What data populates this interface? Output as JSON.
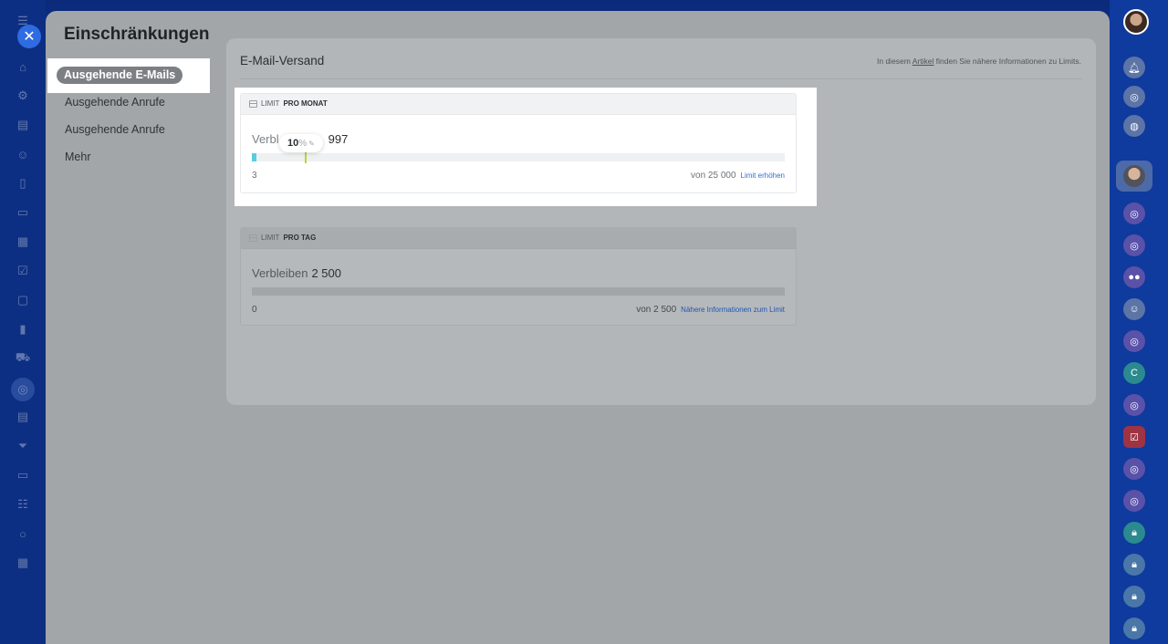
{
  "modal": {
    "title": "Einschränkungen",
    "menu": [
      {
        "label": "Ausgehende E-Mails",
        "active": true
      },
      {
        "label": "Ausgehende Anrufe"
      },
      {
        "label": "Ausgehende Anrufe"
      },
      {
        "label": "Mehr"
      }
    ]
  },
  "content": {
    "title": "E-Mail-Versand",
    "note_before": "In diesem",
    "note_link": "Artikel",
    "note_after": "finden Sie nähere Informationen zu Limits."
  },
  "monthly": {
    "head_prefix": "LIMIT",
    "head_strong": "PRO MONAT",
    "remain_label": "Verbl",
    "remain_value": "997",
    "used": "3",
    "of": "von 25 000",
    "action": "Limit erhöhen",
    "used_fraction": 0.0012,
    "marker_percent": 10,
    "tooltip_value": "10",
    "tooltip_unit": "%"
  },
  "daily": {
    "head_prefix": "LIMIT",
    "head_strong": "PRO TAG",
    "remain_label": "Verbleiben",
    "remain_value": "2 500",
    "used": "0",
    "of": "von 2 500",
    "action": "Nähere Informationen zum Limit",
    "used_fraction": 0
  },
  "icons": {
    "close": "close-icon",
    "right_rail": [
      "bell-icon",
      "target-icon",
      "chat-icon"
    ]
  },
  "colors": {
    "accent": "#2f6be2",
    "bar_fill": "#58cde0",
    "marker": "#b7d636",
    "link": "#2f6fd6"
  },
  "right_rail": {
    "letter_badge": "C"
  }
}
